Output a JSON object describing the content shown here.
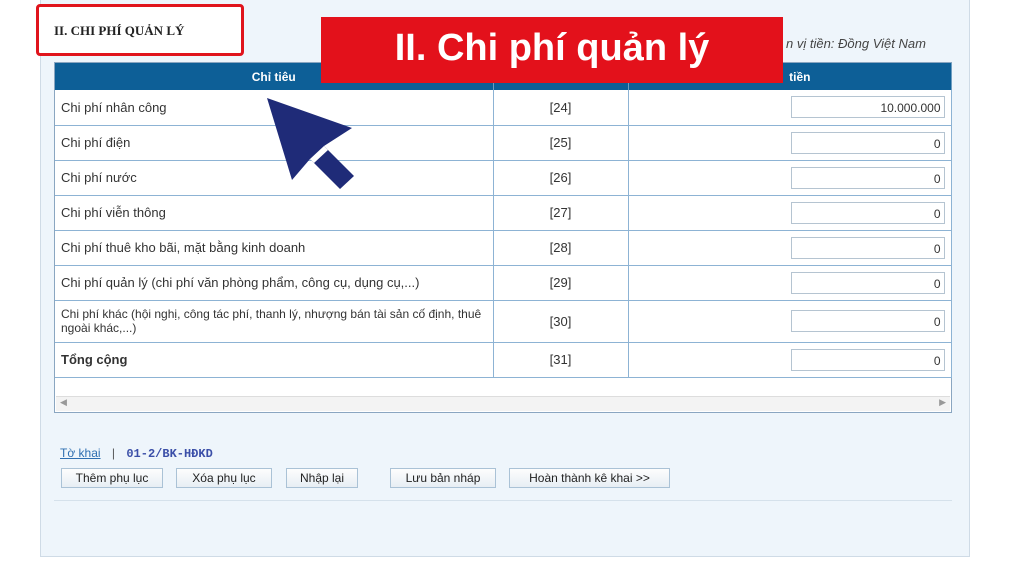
{
  "section": {
    "title": "II. CHI PHÍ QUẢN LÝ"
  },
  "banner": {
    "text": "II. Chi phí quản lý"
  },
  "unit_label": "n vị tiền: Đồng Việt Nam",
  "table": {
    "headers": [
      "Chỉ tiêu",
      "",
      "tiền"
    ],
    "rows": [
      {
        "name": "Chi phí nhân công",
        "code": "[24]",
        "value": "10.000.000"
      },
      {
        "name": "Chi phí điện",
        "code": "[25]",
        "value": "0"
      },
      {
        "name": "Chi phí nước",
        "code": "[26]",
        "value": "0"
      },
      {
        "name": "Chi phí viễn thông",
        "code": "[27]",
        "value": "0"
      },
      {
        "name": "Chi phí thuê kho bãi, mặt bằng kinh doanh",
        "code": "[28]",
        "value": "0"
      },
      {
        "name": "Chi phí quản lý (chi phí văn phòng phẩm, công cụ, dụng cụ,...)",
        "code": "[29]",
        "value": "0"
      },
      {
        "name": "Chi phí khác (hội nghị, công tác phí, thanh lý, nhượng bán tài sản cố định, thuê ngoài khác,...)",
        "code": "[30]",
        "value": "0"
      },
      {
        "name": "Tổng cộng",
        "code": "[31]",
        "value": "0"
      }
    ]
  },
  "links": {
    "to_khai": "Tờ khai",
    "separator": "|",
    "form_id": "01-2/BK-HĐKD"
  },
  "buttons": {
    "add_appendix": "Thêm phụ lục",
    "delete_appendix": "Xóa phụ lục",
    "reset": "Nhập lại",
    "save_draft": "Lưu bản nháp",
    "complete": "Hoàn thành kê khai >>"
  },
  "icons": {
    "cursor": "pointer-arrow-icon"
  },
  "colors": {
    "header_bg": "#0d5f97",
    "banner_bg": "#e3111b",
    "highlight_border": "#e0141c",
    "cursor": "#1f2b78"
  }
}
